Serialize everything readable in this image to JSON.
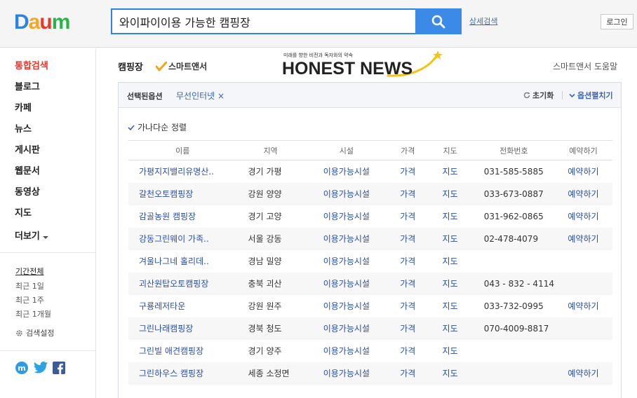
{
  "header": {
    "logo": "Daum",
    "search_value": "와이파이이용 가능한 캠핑장",
    "detail_search": "상세검색",
    "login": "로그인"
  },
  "sidebar": {
    "items": [
      {
        "label": "통합검색",
        "active": true
      },
      {
        "label": "블로그"
      },
      {
        "label": "카페"
      },
      {
        "label": "뉴스"
      },
      {
        "label": "게시판"
      },
      {
        "label": "웹문서"
      },
      {
        "label": "동영상"
      },
      {
        "label": "지도"
      },
      {
        "label": "더보기"
      }
    ],
    "period_title": "기간전체",
    "periods": [
      "최근 1일",
      "최근 1주",
      "최근 1개월"
    ],
    "search_setting": "검색설정"
  },
  "main": {
    "section_title": "캠핑장",
    "smart_answer": "스마트앤서",
    "banner_tagline": "미래를 향한 비전과 독자와의 약속",
    "banner_title": "HONEST NEWS",
    "help": "스마트앤서 도움말",
    "options": {
      "label": "선택된옵션",
      "value": "무선인터넷",
      "remove": "×",
      "reset": "초기화",
      "expand": "옵션펼치기"
    },
    "sort": "가나다순 정렬",
    "columns": [
      "이름",
      "지역",
      "시설",
      "가격",
      "지도",
      "전화번호",
      "예약하기"
    ],
    "rows": [
      {
        "name": "가평지지밸리유명산..",
        "region": "경기 가평",
        "facility": "이용가능시설",
        "price": "가격",
        "map": "지도",
        "phone": "031-585-5885",
        "reserve": "예약하기"
      },
      {
        "name": "갈천오토캠핑장",
        "region": "강원 양양",
        "facility": "이용가능시설",
        "price": "가격",
        "map": "지도",
        "phone": "033-673-0887",
        "reserve": "예약하기"
      },
      {
        "name": "감골농원 캠핑장",
        "region": "경기 고양",
        "facility": "이용가능시설",
        "price": "가격",
        "map": "지도",
        "phone": "031-962-0865",
        "reserve": "예약하기"
      },
      {
        "name": "강동그린웨이 가족..",
        "region": "서울 강동",
        "facility": "이용가능시설",
        "price": "가격",
        "map": "지도",
        "phone": "02-478-4079",
        "reserve": "예약하기"
      },
      {
        "name": "겨울나그네 홀리데..",
        "region": "경남 밀양",
        "facility": "이용가능시설",
        "price": "가격",
        "map": "지도",
        "phone": "",
        "reserve": ""
      },
      {
        "name": "괴산원탑오토캠핑장",
        "region": "충북 괴산",
        "facility": "이용가능시설",
        "price": "가격",
        "map": "지도",
        "phone": "043 - 832 - 4114",
        "reserve": ""
      },
      {
        "name": "구룡레저타운",
        "region": "강원 원주",
        "facility": "이용가능시설",
        "price": "가격",
        "map": "지도",
        "phone": "033-732-0995",
        "reserve": "예약하기"
      },
      {
        "name": "그린나래캠핑장",
        "region": "경북 청도",
        "facility": "이용가능시설",
        "price": "가격",
        "map": "지도",
        "phone": "070-4009-8817",
        "reserve": ""
      },
      {
        "name": "그린빌 애견캠핑장",
        "region": "경기 양주",
        "facility": "이용가능시설",
        "price": "가격",
        "map": "지도",
        "phone": "",
        "reserve": ""
      },
      {
        "name": "그린하우스 캠핑장",
        "region": "세종 소정면",
        "facility": "이용가능시설",
        "price": "가격",
        "map": "지도",
        "phone": "",
        "reserve": "예약하기"
      }
    ]
  },
  "colors": {
    "accent_blue": "#3b8ae8",
    "link_blue": "#2a4fa8",
    "active_red": "#e6392e"
  }
}
